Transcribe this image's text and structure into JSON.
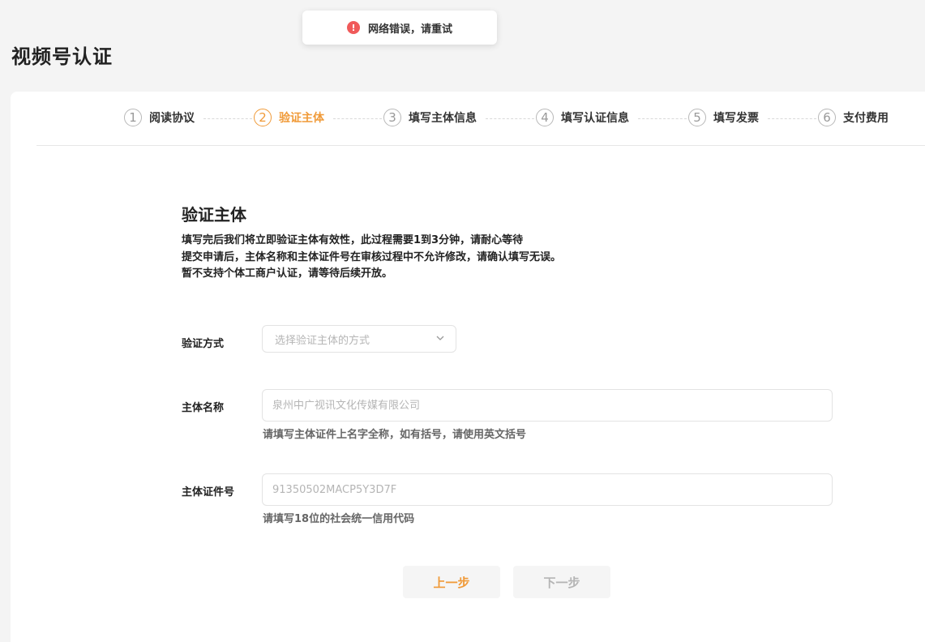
{
  "toast": {
    "icon": "error-icon",
    "icon_glyph": "!",
    "message": "网络错误，请重试"
  },
  "page": {
    "title": "视频号认证"
  },
  "steps": [
    {
      "num": "1",
      "label": "阅读协议",
      "active": false
    },
    {
      "num": "2",
      "label": "验证主体",
      "active": true
    },
    {
      "num": "3",
      "label": "填写主体信息",
      "active": false
    },
    {
      "num": "4",
      "label": "填写认证信息",
      "active": false
    },
    {
      "num": "5",
      "label": "填写发票",
      "active": false
    },
    {
      "num": "6",
      "label": "支付费用",
      "active": false
    }
  ],
  "section": {
    "title": "验证主体",
    "desc_lines": [
      "填写完后我们将立即验证主体有效性，此过程需要1到3分钟，请耐心等待",
      "提交申请后，主体名称和主体证件号在审核过程中不允许修改，请确认填写无误。",
      "暂不支持个体工商户认证，请等待后续开放。"
    ]
  },
  "form": {
    "method": {
      "label": "验证方式",
      "placeholder": "选择验证主体的方式"
    },
    "name": {
      "label": "主体名称",
      "placeholder": "泉州中广视讯文化传媒有限公司",
      "hint": "请填写主体证件上名字全称，如有括号，请使用英文括号"
    },
    "id_number": {
      "label": "主体证件号",
      "placeholder": "91350502MACP5Y3D7F",
      "hint": "请填写18位的社会统一信用代码"
    }
  },
  "buttons": {
    "prev": "上一步",
    "next": "下一步"
  },
  "colors": {
    "accent": "#f09a38",
    "error": "#f05a5a"
  }
}
